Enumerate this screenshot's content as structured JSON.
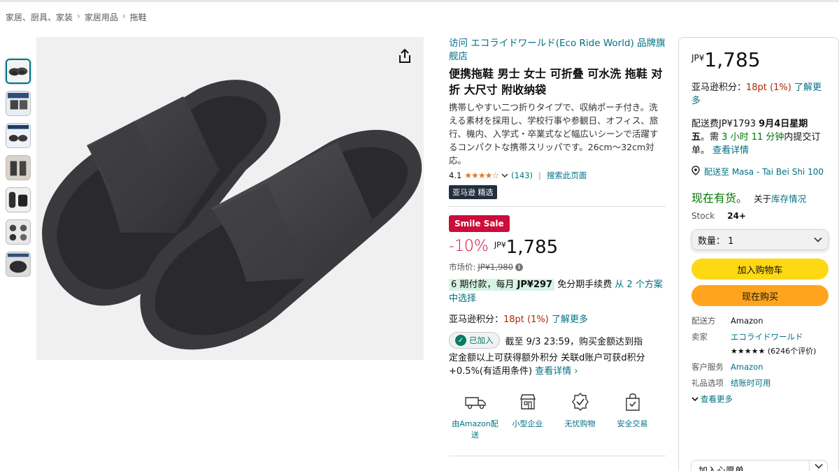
{
  "breadcrumb": [
    "家居、厨具、家装",
    "家居用品",
    "拖鞋"
  ],
  "breadcrumb_sep": "›",
  "center": {
    "brand_link": "访问 エコライドワールド(Eco Ride World) 品牌旗舰店",
    "title": "便携拖鞋 男士 女士 可折叠 可水洗 拖鞋 对折 大尺寸 附收纳袋",
    "description": "携帯しやすい二つ折りタイプで、収納ポーチ付き。洗える素材を採用し、学校行事や参観日、オフィス、旅行、機内、入学式・卒業式など幅広いシーンで活躍するコンパクトな携帯スリッパです。26cm〜32cm対応。",
    "rating_value": "4.1",
    "stars": "★★★★☆",
    "rating_count": "(143)",
    "search_page": "搜索此页面",
    "separator": "|",
    "choice_badge": "亚马逊 精选",
    "sale_badge": "Smile Sale",
    "discount": "-10%",
    "currency": "JP¥",
    "price": "1,785",
    "list_price_label": "市场价:",
    "list_price": "JP¥1,980",
    "install_prefix": "6 期付款，每月",
    "install_amount": "JP¥297",
    "install_mid": "免分期手续费",
    "install_link": "从 2 个方案中选择",
    "points_label": "亚马逊积分：",
    "points_value": "18pt",
    "points_pct": "(1%)",
    "points_more": "了解更多",
    "added_label": "已加入",
    "promo_text": "截至 9/3 23:59，购买金额达到指",
    "promo_text2": "定金额以上可获得额外积分 关联d账户可获d积分+0.5%(有适用条件)",
    "promo_link": "查看详情 ›",
    "features": [
      {
        "icon": "truck-icon",
        "label": "由Amazon配送"
      },
      {
        "icon": "shop-icon",
        "label": "小型企业"
      },
      {
        "icon": "badge-icon",
        "label": "无忧购物"
      },
      {
        "icon": "secure-bag-icon",
        "label": "安全交易"
      }
    ]
  },
  "buybox": {
    "currency": "JP¥",
    "price": "1,785",
    "points_label": "亚马逊积分：",
    "points_value": "18pt",
    "points_pct": "(1%)",
    "points_more": "了解更多",
    "delivery_prefix": "配送费JP¥1793",
    "delivery_date": "9月4日星期五",
    "delivery_mid": "。需",
    "delivery_time": "3 小时 11 分钟",
    "delivery_suffix": "内提交订单。",
    "delivery_link": "查看详情",
    "location": "配送至 Masa - Tai Bei Shi 100",
    "stock": "现在有货。",
    "stock_link_prefix": "关于",
    "stock_link": "库存情况",
    "stock_label": "Stock",
    "stock_count": "24+",
    "qty_label": "数量：",
    "qty_value": "1",
    "cart_button": "加入购物车",
    "buy_button": "现在购买",
    "shipper_label": "配送方",
    "shipper": "Amazon",
    "seller_label": "卖家",
    "seller": "エコライドワールド",
    "seller_stars": "★★★★★",
    "seller_ratings": "(6246个评价)",
    "service_label": "客户服务",
    "service": "Amazon",
    "gift_label": "礼品选项",
    "gift": "结账时可用",
    "see_more": "查看更多",
    "wishlist": "加入心愿单"
  },
  "colors": {
    "link": "#007185",
    "price_red": "#cc0c39",
    "cart_yellow": "#ffd814",
    "buy_orange": "#ffa41c",
    "in_stock_green": "#007600"
  }
}
